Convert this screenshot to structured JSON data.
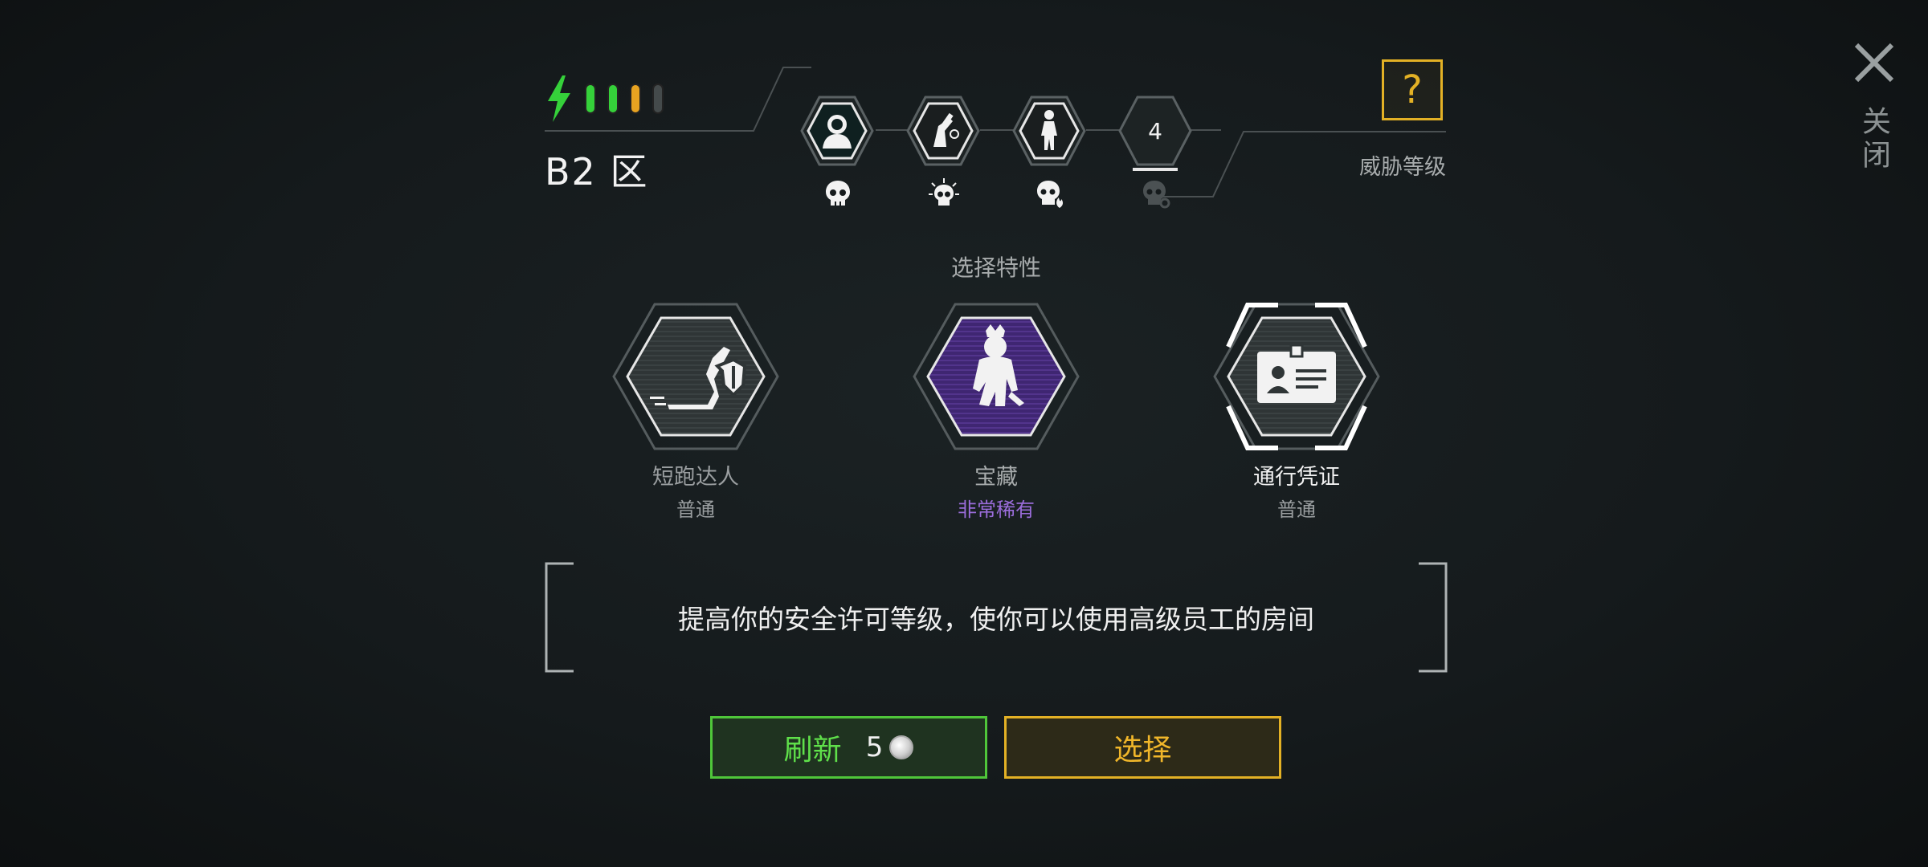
{
  "header": {
    "zone_title": "B2 区",
    "threat_level_label": "威胁等级",
    "help_label": "?",
    "energy": {
      "pips": [
        "#35d13a",
        "#35d13a",
        "#e8a321",
        "#444a4b"
      ]
    }
  },
  "threat_track": [
    {
      "icon": "hooded-figure-icon",
      "skull": "skull-icon",
      "active": true
    },
    {
      "icon": "weapon-hand-icon",
      "skull": "skull-sun-icon",
      "active": true
    },
    {
      "icon": "zombie-figure-icon",
      "skull": "skull-fire-icon",
      "active": true
    },
    {
      "label": "4",
      "skull": "skull-locked-icon",
      "active": false
    }
  ],
  "close": {
    "label": "关闭",
    "icon": "close-icon"
  },
  "section_label": "选择特性",
  "traits": [
    {
      "name": "短跑达人",
      "rarity": "普通",
      "icon": "sprint-shield-icon",
      "selected": false,
      "rarity_color": "#9a9ea0"
    },
    {
      "name": "宝藏",
      "rarity": "非常稀有",
      "icon": "treasure-monster-icon",
      "selected": false,
      "rarity_color": "#9b6ddb"
    },
    {
      "name": "通行凭证",
      "rarity": "普通",
      "icon": "id-card-icon",
      "selected": true,
      "rarity_color": "#9a9ea0"
    }
  ],
  "description": "提高你的安全许可等级，使你可以使用高级员工的房间",
  "buttons": {
    "refresh_label": "刷新",
    "refresh_cost": "5",
    "select_label": "选择"
  },
  "colors": {
    "accent_yellow": "#e3b125",
    "accent_green": "#4fc63a",
    "rare_purple": "#9b6ddb"
  }
}
